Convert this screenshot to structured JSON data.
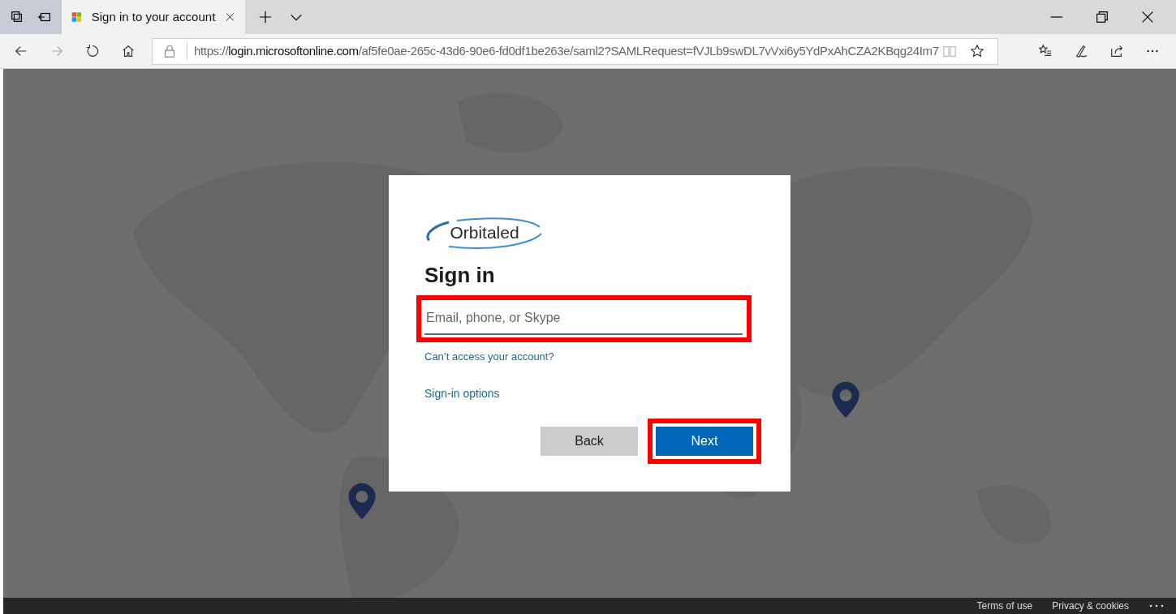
{
  "browser": {
    "tab": {
      "title": "Sign in to your account",
      "selected": true
    },
    "url": {
      "scheme": "https://",
      "host": "login.microsoftonline.com",
      "rest": "/af5fe0ae-265c-43d6-90e6-fd0df1be263e/saml2?SAMLRequest=fVJLb9swDL7vVxi6y5YdPxAhCZA2KBqg24Im7"
    }
  },
  "signin": {
    "logo_text": "Orbitaled",
    "heading": "Sign in",
    "email_field": {
      "placeholder": "Email, phone, or Skype",
      "highlighted": true
    },
    "links": [
      "Can’t access your account?",
      "Sign-in options"
    ],
    "buttons": [
      {
        "label": "Back",
        "kind": "secondary",
        "highlighted": false
      },
      {
        "label": "Next",
        "kind": "primary",
        "highlighted": true
      }
    ]
  },
  "footer": {
    "links": [
      "Terms of use",
      "Privacy & cookies"
    ]
  }
}
